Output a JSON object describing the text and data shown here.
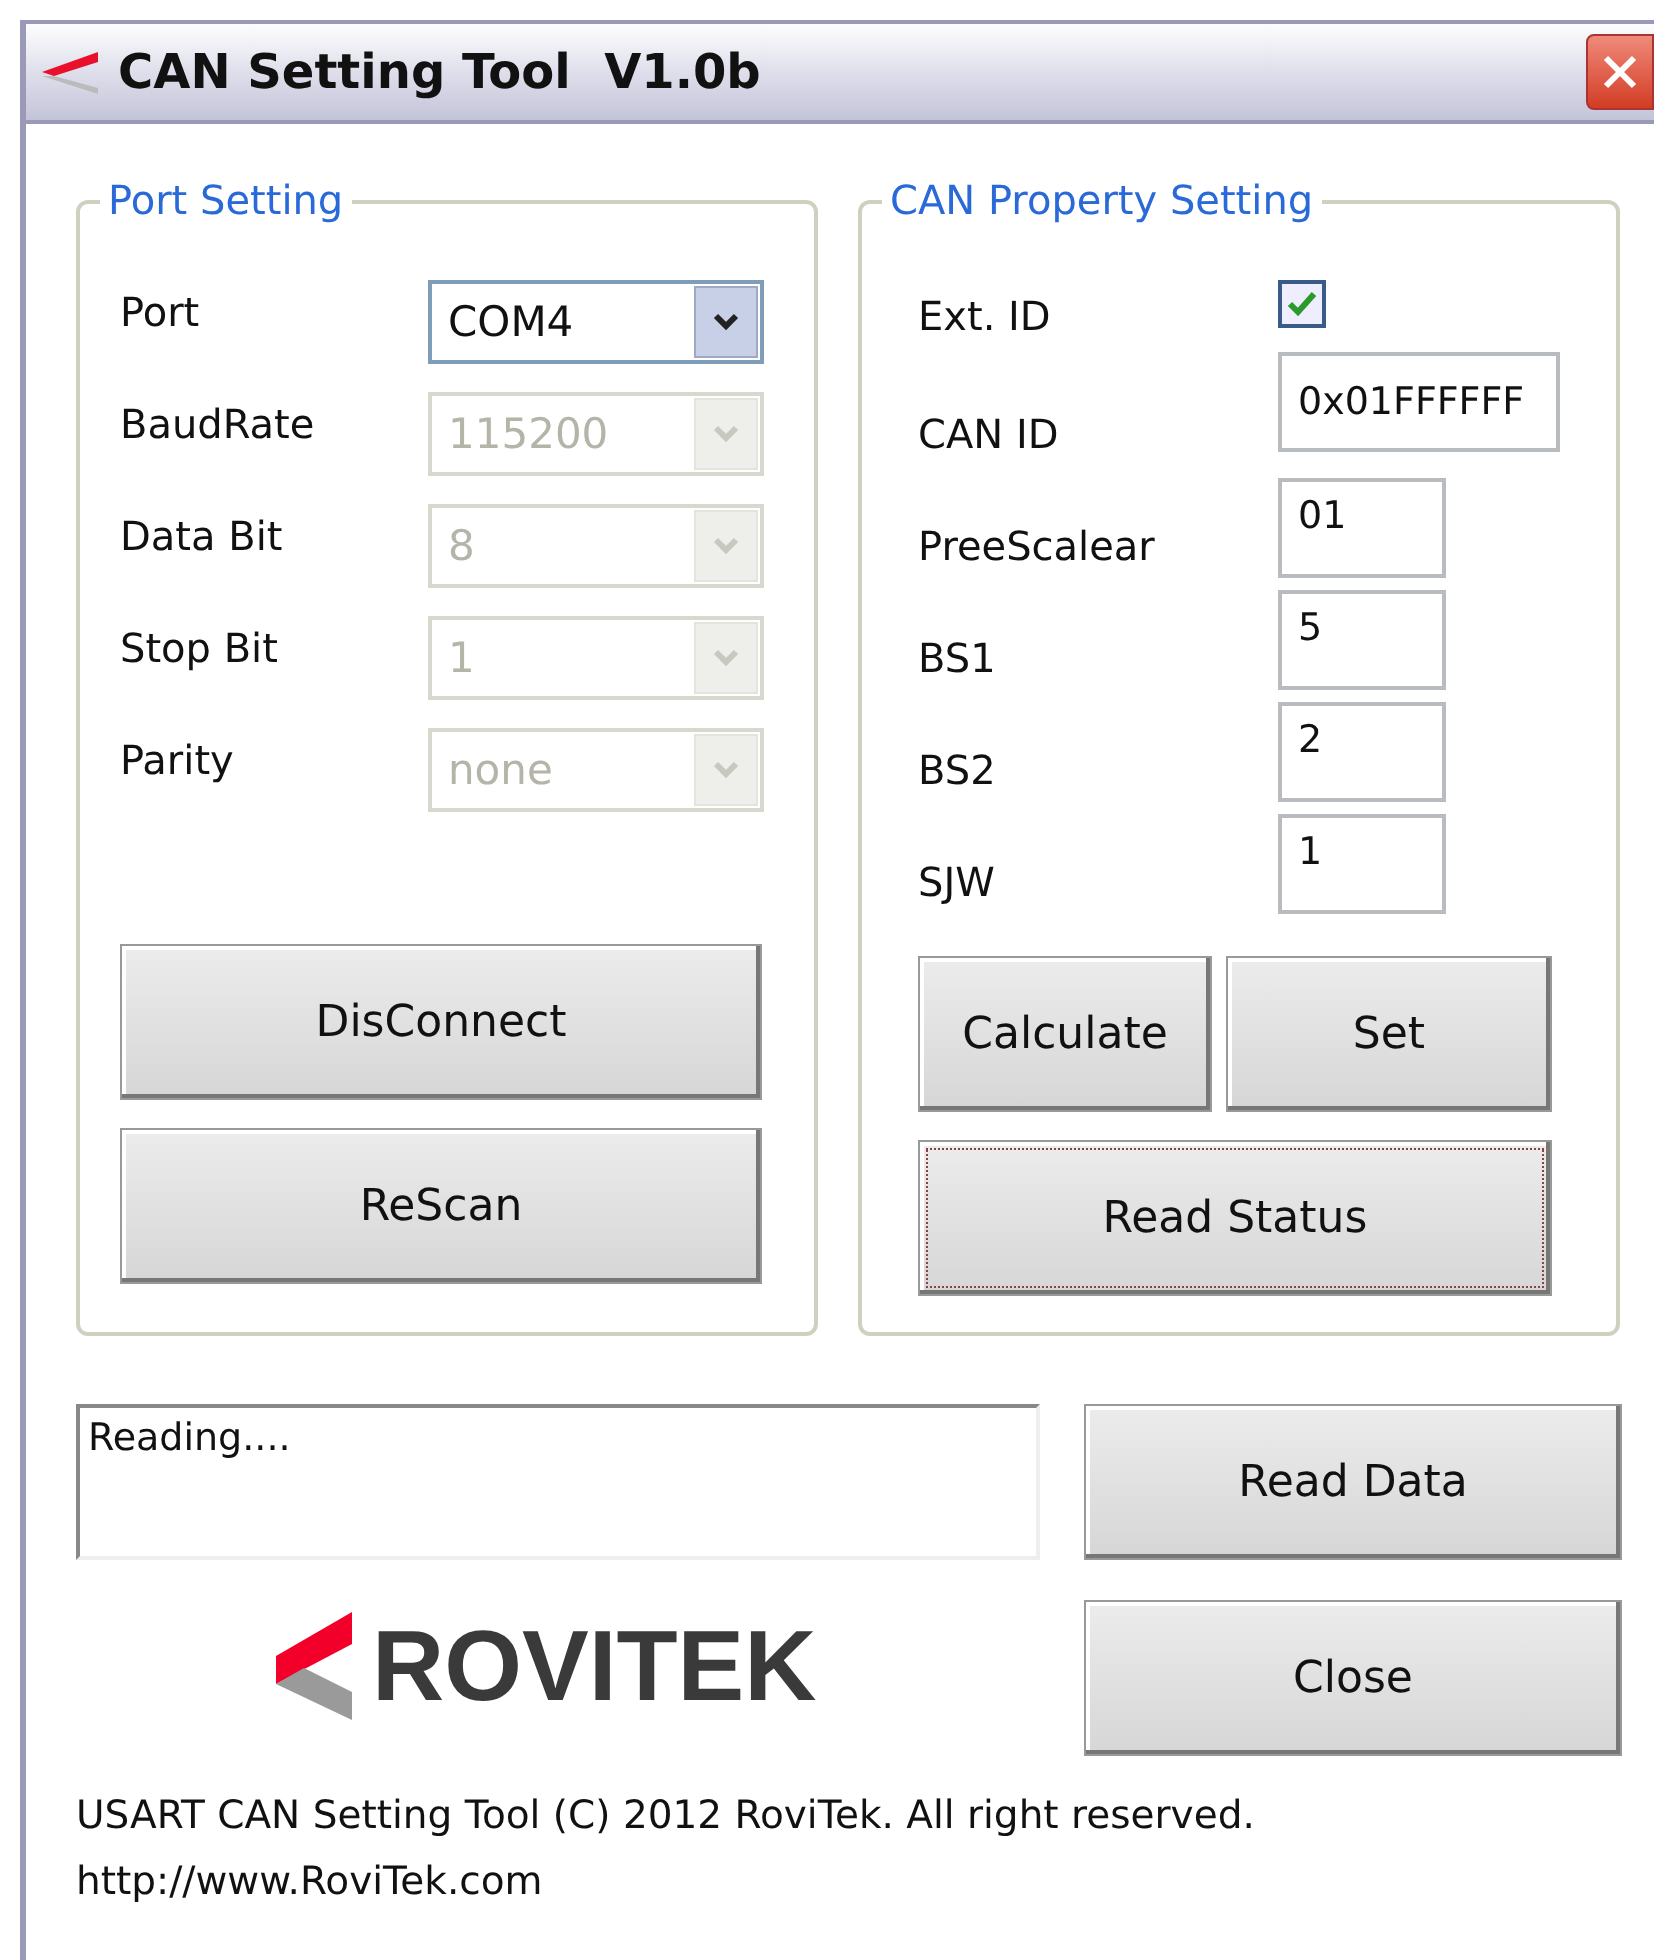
{
  "window": {
    "title": "CAN Setting Tool  V1.0b"
  },
  "port_setting": {
    "title": "Port Setting",
    "fields": [
      {
        "label": "Port",
        "value": "COM4",
        "disabled": false
      },
      {
        "label": "BaudRate",
        "value": "115200",
        "disabled": true
      },
      {
        "label": "Data Bit",
        "value": "8",
        "disabled": true
      },
      {
        "label": "Stop Bit",
        "value": "1",
        "disabled": true
      },
      {
        "label": "Parity",
        "value": "none",
        "disabled": true
      }
    ],
    "buttons": [
      {
        "label": "DisConnect",
        "focused": false
      },
      {
        "label": "ReScan",
        "focused": false
      }
    ]
  },
  "can_property_setting": {
    "title": "CAN Property Setting",
    "ext_id": {
      "label": "Ext. ID",
      "checked": true
    },
    "fields": [
      {
        "label": "CAN ID",
        "value": "0x01FFFFFF",
        "kind": "wide"
      },
      {
        "label": "PreeScalear",
        "value": "01",
        "kind": "narrow"
      },
      {
        "label": "BS1",
        "value": "5",
        "kind": "narrow"
      },
      {
        "label": "BS2",
        "value": "2",
        "kind": "narrow"
      },
      {
        "label": "SJW",
        "value": "1",
        "kind": "narrow"
      }
    ],
    "buttons": [
      {
        "label": "Calculate",
        "focused": false
      },
      {
        "label": "Set",
        "focused": false
      },
      {
        "label": "Read Status",
        "focused": true
      }
    ]
  },
  "output": {
    "value": "Reading...."
  },
  "buttons": [
    {
      "label": "Read Data",
      "focused": false
    },
    {
      "label": "Close",
      "focused": false
    }
  ],
  "logo": {
    "text": "ROVITEK"
  },
  "footer": [
    "USART CAN Setting Tool (C) 2012 RoviTek. All right reserved.",
    "http://www.RoviTek.com"
  ]
}
